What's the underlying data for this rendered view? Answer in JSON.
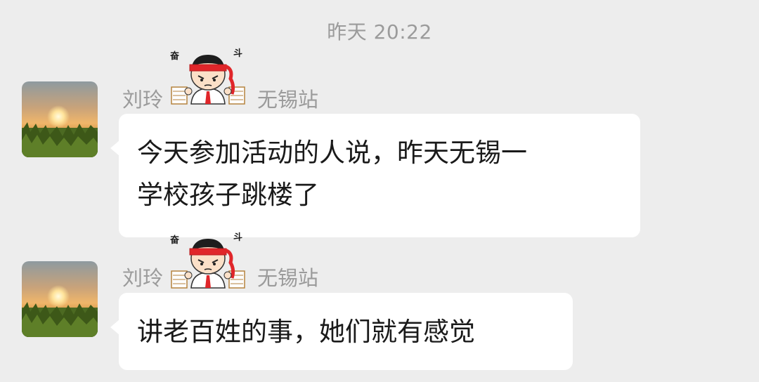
{
  "timestamp": "昨天 20:22",
  "messages": [
    {
      "sender_name": "刘玲",
      "sender_location": "无锡站",
      "badge": {
        "left": "奋",
        "right": "斗"
      },
      "lines": [
        "今天参加活动的人说，昨天无锡一",
        "学校孩子跳楼了"
      ]
    },
    {
      "sender_name": "刘玲",
      "sender_location": "无锡站",
      "badge": {
        "left": "奋",
        "right": "斗"
      },
      "lines": [
        "讲老百姓的事，她们就有感觉"
      ]
    }
  ],
  "colors": {
    "background": "#ededed",
    "bubble": "#ffffff",
    "meta_text": "#9b9b9b",
    "message_text": "#1a1a1a",
    "headband": "#e0262a"
  },
  "icons": {
    "avatar": "sunset-avatar-icon",
    "sticker": "fendou-boy-sticker-icon"
  }
}
